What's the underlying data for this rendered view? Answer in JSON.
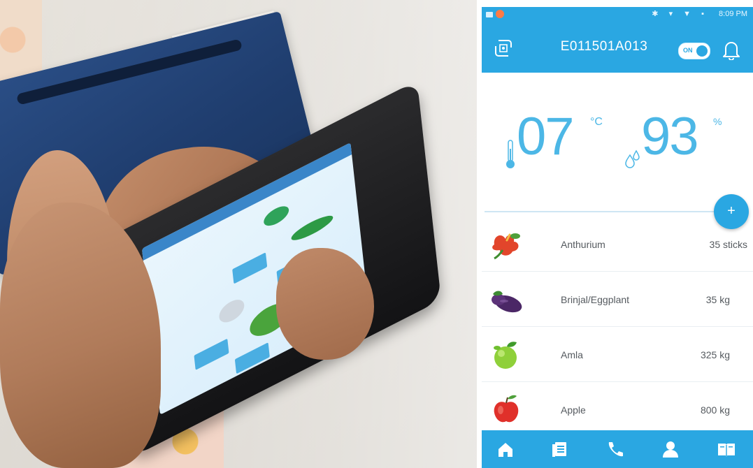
{
  "app": {
    "device_id": "E011501A013",
    "toggle_label": "ON",
    "status_time": "8:09 PM"
  },
  "readings": {
    "temperature": "07",
    "temperature_unit": "°C",
    "humidity": "93",
    "humidity_unit": "%"
  },
  "produce": [
    {
      "name": "Anthurium",
      "quantity": "35 sticks",
      "icon": "anthurium-icon"
    },
    {
      "name": "Brinjal/Eggplant",
      "quantity": "35 kg",
      "icon": "eggplant-icon"
    },
    {
      "name": "Amla",
      "quantity": "325 kg",
      "icon": "amla-icon"
    },
    {
      "name": "Apple",
      "quantity": "800 kg",
      "icon": "apple-icon"
    }
  ],
  "fab_label": "+",
  "nav": [
    {
      "icon": "home-icon"
    },
    {
      "icon": "list-icon"
    },
    {
      "icon": "phone-icon"
    },
    {
      "icon": "profile-icon"
    },
    {
      "icon": "book-icon"
    }
  ],
  "colors": {
    "accent": "#2aa7e2",
    "reading": "#4cb7e6",
    "text": "#555a5f"
  }
}
